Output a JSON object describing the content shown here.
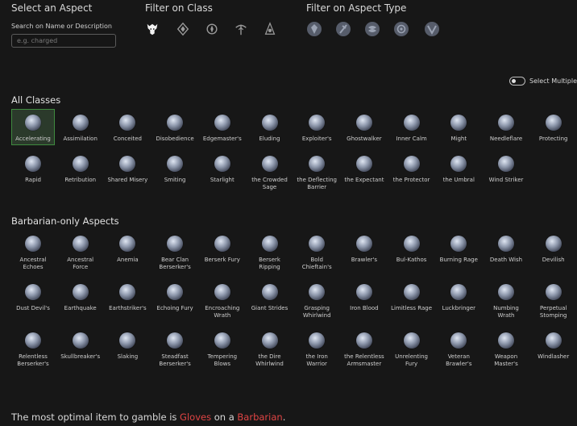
{
  "header": {
    "select_aspect": "Select an Aspect",
    "filter_class": "Filter on Class",
    "filter_type": "Filter on Aspect Type"
  },
  "search": {
    "label": "Search on Name or Description",
    "placeholder": "e.g. charged",
    "value": ""
  },
  "class_filters": [
    "barbarian-icon",
    "druid-icon",
    "necromancer-icon",
    "rogue-icon",
    "sorcerer-icon"
  ],
  "type_filters": [
    "defensive-icon",
    "offensive-icon",
    "resource-icon",
    "utility-icon",
    "mobility-icon"
  ],
  "toggle": {
    "label": "Select Multiple",
    "on": false
  },
  "all_classes": {
    "title": "All Classes",
    "selected": "Accelerating",
    "items": [
      "Accelerating",
      "Assimilation",
      "Conceited",
      "Disobedience",
      "Edgemaster's",
      "Eluding",
      "Exploiter's",
      "Ghostwalker",
      "Inner Calm",
      "Might",
      "Needleflare",
      "Protecting",
      "Rapid",
      "Retribution",
      "Shared Misery",
      "Smiting",
      "Starlight",
      "the Crowded Sage",
      "the Deflecting Barrier",
      "the Expectant",
      "the Protector",
      "the Umbral",
      "Wind Striker"
    ]
  },
  "barbarian": {
    "title": "Barbarian-only Aspects",
    "items": [
      "Ancestral Echoes",
      "Ancestral Force",
      "Anemia",
      "Bear Clan Berserker's",
      "Berserk Fury",
      "Berserk Ripping",
      "Bold Chieftain's",
      "Brawler's",
      "Bul-Kathos",
      "Burning Rage",
      "Death Wish",
      "Devilish",
      "Dust Devil's",
      "Earthquake",
      "Earthstriker's",
      "Echoing Fury",
      "Encroaching Wrath",
      "Giant Strides",
      "Grasping Whirlwind",
      "Iron Blood",
      "Limitless Rage",
      "Luckbringer",
      "Numbing Wrath",
      "Perpetual Stomping",
      "Relentless Berserker's",
      "Skullbreaker's",
      "Slaking",
      "Steadfast Berserker's",
      "Tempering Blows",
      "the Dire Whirlwind",
      "the Iron Warrior",
      "the Relentless Armsmaster",
      "Unrelenting Fury",
      "Veteran Brawler's",
      "Weapon Master's",
      "Windlasher"
    ]
  },
  "footer": {
    "prefix": "The most optimal item to gamble is ",
    "item": "Gloves",
    "middle": " on a ",
    "class": "Barbarian",
    "suffix": "."
  },
  "colors": {
    "highlight": "#e04444",
    "selected_border": "#3f8a3f"
  }
}
